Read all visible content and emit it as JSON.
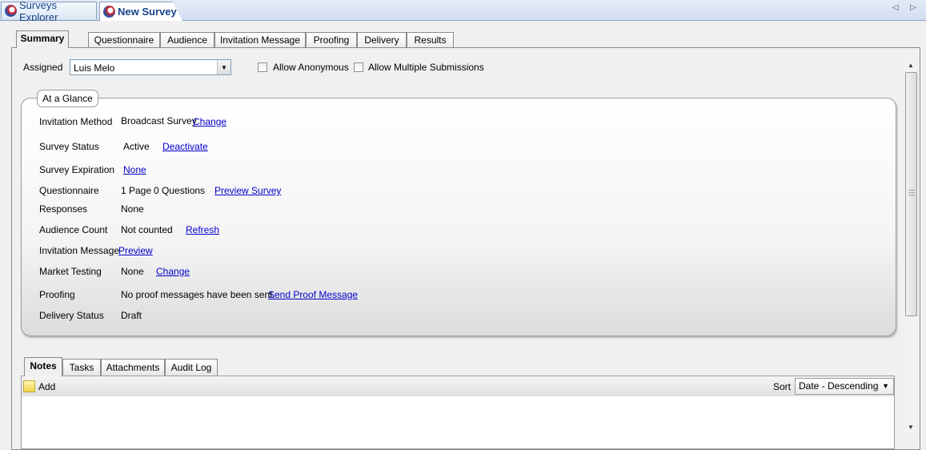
{
  "doc_tabs": [
    {
      "label": "Surveys Explorer"
    },
    {
      "label": "New Survey"
    }
  ],
  "scroll_arrows": "◁ ▷",
  "section_tabs": [
    {
      "label": "Summary"
    },
    {
      "label": "Questionnaire"
    },
    {
      "label": "Audience"
    },
    {
      "label": "Invitation Message"
    },
    {
      "label": "Proofing"
    },
    {
      "label": "Delivery"
    },
    {
      "label": "Results"
    }
  ],
  "assigned": {
    "label": "Assigned",
    "value": "Luis Melo"
  },
  "options": {
    "allow_anonymous": "Allow Anonymous",
    "allow_multiple": "Allow Multiple Submissions"
  },
  "glance": {
    "title": "At a Glance",
    "invitation_method": {
      "label": "Invitation Method",
      "value": "Broadcast Survey",
      "link": "Change"
    },
    "survey_status": {
      "label": "Survey Status",
      "value": "Active",
      "link": "Deactivate"
    },
    "survey_expiration": {
      "label": "Survey Expiration",
      "link": "None"
    },
    "questionnaire": {
      "label": "Questionnaire",
      "pages": "1 Page",
      "questions": "0 Questions",
      "link": "Preview Survey"
    },
    "responses": {
      "label": "Responses",
      "value": "None"
    },
    "audience_count": {
      "label": "Audience Count",
      "value": "Not counted",
      "link": "Refresh"
    },
    "invitation_message": {
      "label": "Invitation Message",
      "link": "Preview"
    },
    "market_testing": {
      "label": "Market Testing",
      "value": "None",
      "link": "Change"
    },
    "proofing": {
      "label": "Proofing",
      "value": "No proof messages have been sent.",
      "link": "Send Proof Message"
    },
    "delivery_status": {
      "label": "Delivery Status",
      "value": "Draft"
    }
  },
  "note_tabs": [
    {
      "label": "Notes"
    },
    {
      "label": "Tasks"
    },
    {
      "label": "Attachments"
    },
    {
      "label": "Audit Log"
    }
  ],
  "notes_toolbar": {
    "add_label": "Add",
    "sort_label": "Sort",
    "sort_value": "Date - Descending"
  }
}
